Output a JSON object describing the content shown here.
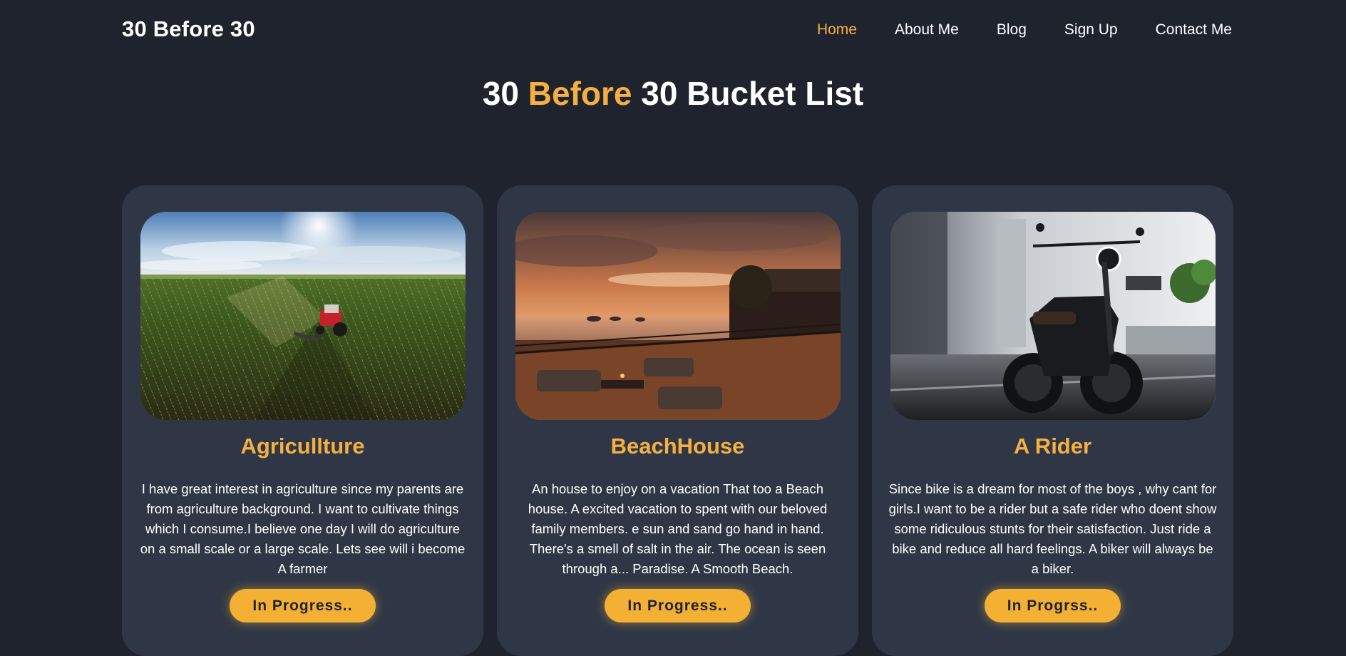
{
  "nav": {
    "brand": "30 Before 30",
    "links": [
      "Home",
      "About Me",
      "Blog",
      "Sign Up",
      "Contact Me"
    ],
    "active": "Home"
  },
  "hero": {
    "title_part1": "30 ",
    "title_accent": "Before",
    "title_part2": " 30 Bucket List"
  },
  "cards": [
    {
      "image": "tractor-field-image",
      "title": "Agricullture",
      "text": "I have great interest in agriculture since my parents are from agriculture background. I want to cultivate things which I consume.I believe one day I will do agriculture on a small scale or a large scale. Lets see will i become A farmer",
      "button": "In Progress.."
    },
    {
      "image": "beach-house-sunset-image",
      "title": "BeachHouse",
      "text": "An house to enjoy on a vacation That too a Beach house. A excited vacation to spent with our beloved family members. e sun and sand go hand in hand. There's a smell of salt in the air. The ocean is seen through a... Paradise. A Smooth Beach.",
      "button": "In Progress.."
    },
    {
      "image": "motorcycle-image",
      "title": "A Rider",
      "text": "Since bike is a dream for most of the boys , why cant for girls.I want to be a rider but a safe rider who doent show some ridiculous stunts for their satisfaction. Just ride a bike and reduce all hard feelings. A biker will always be a biker.",
      "button": "In Progrss.."
    }
  ],
  "colors": {
    "background": "#1f232d",
    "card": "#2f3746",
    "accent": "#f5b041"
  }
}
